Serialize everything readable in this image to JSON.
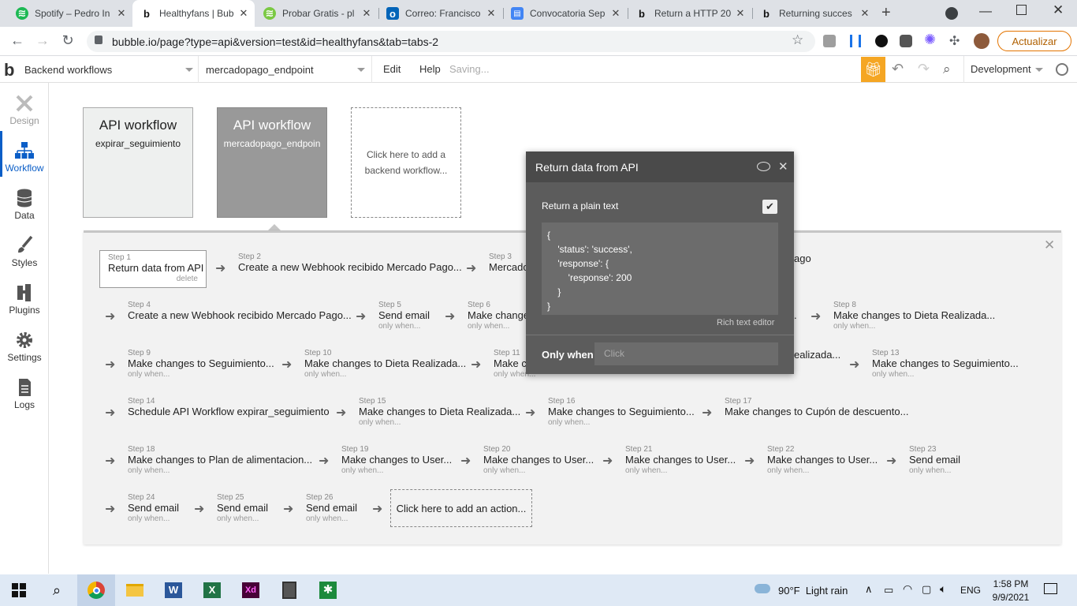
{
  "browser": {
    "tabs": [
      {
        "title": "Spotify – Pedro In",
        "color": "#1db954",
        "glyph": "≋"
      },
      {
        "title": "Healthyfans | Bub",
        "color": "#ffffff",
        "glyph": "b",
        "active": true
      },
      {
        "title": "Probar Gratis - pl",
        "color": "#7ac943",
        "glyph": "≋"
      },
      {
        "title": "Correo: Francisco",
        "color": "#0364b8",
        "glyph": "o"
      },
      {
        "title": "Convocatoria Sep",
        "color": "#4285f4",
        "glyph": "▤"
      },
      {
        "title": "Return a HTTP 20",
        "color": "#ffffff",
        "glyph": "b"
      },
      {
        "title": "Returning succes",
        "color": "#ffffff",
        "glyph": "b"
      }
    ],
    "url": "bubble.io/page?type=api&version=test&id=healthyfans&tab=tabs-2",
    "update_label": "Actualizar"
  },
  "appbar": {
    "section": "Backend workflows",
    "workflow": "mercadopago_endpoint",
    "edit": "Edit",
    "help": "Help",
    "status": "Saving...",
    "env": "Development"
  },
  "leftnav": [
    {
      "label": "Design"
    },
    {
      "label": "Workflow"
    },
    {
      "label": "Data"
    },
    {
      "label": "Styles"
    },
    {
      "label": "Plugins"
    },
    {
      "label": "Settings"
    },
    {
      "label": "Logs"
    }
  ],
  "cards": [
    {
      "title": "API workflow",
      "name": "expirar_seguimiento"
    },
    {
      "title": "API workflow",
      "name": "mercadopago_endpoin"
    },
    {
      "add": "Click here to add a backend workflow..."
    }
  ],
  "steps": [
    {
      "n": "Step 1",
      "t": "Return data from API",
      "o": "delete"
    },
    {
      "n": "Step 2",
      "t": "Create a new Webhook recibido Mercado Pago...",
      "o": ""
    },
    {
      "n": "Step 3",
      "t": "Mercado",
      "o": ""
    },
    {
      "n": "",
      "t": "ago",
      "o": ""
    },
    {
      "n": "Step 4",
      "t": "Create a new Webhook recibido Mercado Pago...",
      "o": ""
    },
    {
      "n": "Step 5",
      "t": "Send email",
      "o": "only when..."
    },
    {
      "n": "Step 6",
      "t": "Make change",
      "o": "only when..."
    },
    {
      "n": "Step 8",
      "t": "Make changes to Dieta Realizada...",
      "o": "only when..."
    },
    {
      "n": "Step 9",
      "t": "Make changes to Seguimiento...",
      "o": "only when..."
    },
    {
      "n": "Step 10",
      "t": "Make changes to Dieta Realizada...",
      "o": "only when..."
    },
    {
      "n": "Step 11",
      "t": "Make c",
      "o": "only when..."
    },
    {
      "n": "",
      "t": "ealizada...",
      "o": "only when..."
    },
    {
      "n": "Step 13",
      "t": "Make changes to Seguimiento...",
      "o": "only when..."
    },
    {
      "n": "Step 14",
      "t": "Schedule API Workflow expirar_seguimiento",
      "o": ""
    },
    {
      "n": "Step 15",
      "t": "Make changes to Dieta Realizada...",
      "o": "only when..."
    },
    {
      "n": "Step 16",
      "t": "Make changes to Seguimiento...",
      "o": "only when..."
    },
    {
      "n": "Step 17",
      "t": "Make changes to Cupón de descuento...",
      "o": ""
    },
    {
      "n": "Step 18",
      "t": "Make changes to Plan de alimentacion...",
      "o": "only when..."
    },
    {
      "n": "Step 19",
      "t": "Make changes to User...",
      "o": "only when..."
    },
    {
      "n": "Step 20",
      "t": "Make changes to User...",
      "o": "only when..."
    },
    {
      "n": "Step 21",
      "t": "Make changes to User...",
      "o": "only when..."
    },
    {
      "n": "Step 22",
      "t": "Make changes to User...",
      "o": "only when..."
    },
    {
      "n": "Step 23",
      "t": "Send email",
      "o": "only when..."
    },
    {
      "n": "Step 24",
      "t": "Send email",
      "o": "only when..."
    },
    {
      "n": "Step 25",
      "t": "Send email",
      "o": "only when..."
    },
    {
      "n": "Step 26",
      "t": "Send email",
      "o": "only when..."
    }
  ],
  "add_action": "Click here to add an action...",
  "popup": {
    "title": "Return data from API",
    "plain_text_label": "Return a plain text",
    "code": "{\n    'status': 'success',\n    'response': {\n        'response': 200\n    }\n}",
    "rich_text": "Rich text editor",
    "only_when": "Only when",
    "click": "Click"
  },
  "taskbar": {
    "weather": "90°F  Light rain",
    "lang": "ENG",
    "time": "1:58 PM",
    "date": "9/9/2021"
  }
}
